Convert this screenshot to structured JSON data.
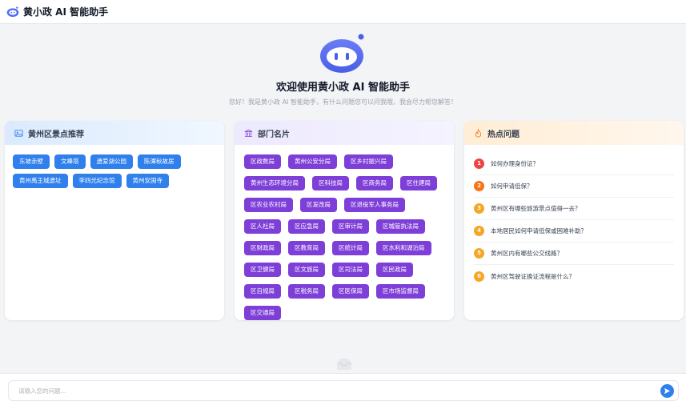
{
  "header": {
    "title": "黄小政 AI 智能助手"
  },
  "hero": {
    "title": "欢迎使用黄小政 AI 智能助手",
    "subtitle": "您好！我是黄小政 AI 智能助手，有什么问题您可以问我哦，我会尽力帮您解答！"
  },
  "scenic": {
    "title": "黄州区景点推荐",
    "items": [
      "东坡赤壁",
      "文峰塔",
      "遗爱湖公园",
      "陈潭秋故居",
      "黄州禹王城遗址",
      "李四光纪念馆",
      "黄州安国寺"
    ]
  },
  "departments": {
    "title": "部门名片",
    "items": [
      "区政数局",
      "黄州公安分局",
      "区乡村振兴局",
      "黄州生态环境分局",
      "区科技局",
      "区商务局",
      "区住建局",
      "区农业农村局",
      "区发改局",
      "区退役军人事务局",
      "区人社局",
      "区应急局",
      "区审计局",
      "区城管执法局",
      "区财政局",
      "区教育局",
      "区统计局",
      "区水利和湖泊局",
      "区卫健局",
      "区文旅局",
      "区司法局",
      "区民政局",
      "区自规局",
      "区税务局",
      "区医保局",
      "区市场监督局",
      "区交通局"
    ]
  },
  "hot": {
    "title": "热点问题",
    "items": [
      {
        "num": "1",
        "text": "如何办理身份证？",
        "color": "#ef4444"
      },
      {
        "num": "2",
        "text": "如何申请低保？",
        "color": "#f97316"
      },
      {
        "num": "3",
        "text": "黄州区有哪些旅游景点值得一去？",
        "color": "#f5a623"
      },
      {
        "num": "4",
        "text": "本地居民如何申请低保或困难补助？",
        "color": "#f5a623"
      },
      {
        "num": "5",
        "text": "黄州区内有哪些公交线路？",
        "color": "#f5a623"
      },
      {
        "num": "6",
        "text": "黄州区驾驶证换证流程是什么？",
        "color": "#f5a623"
      }
    ]
  },
  "input": {
    "placeholder": "请输入您的问题..."
  },
  "colors": {
    "primary": "#2f80ed",
    "purple": "#7e3ed8",
    "accent_orange": "#f97316"
  },
  "icons": [
    "robot-logo-icon",
    "image-icon",
    "building-icon",
    "fire-icon",
    "inbox-icon",
    "send-icon"
  ]
}
